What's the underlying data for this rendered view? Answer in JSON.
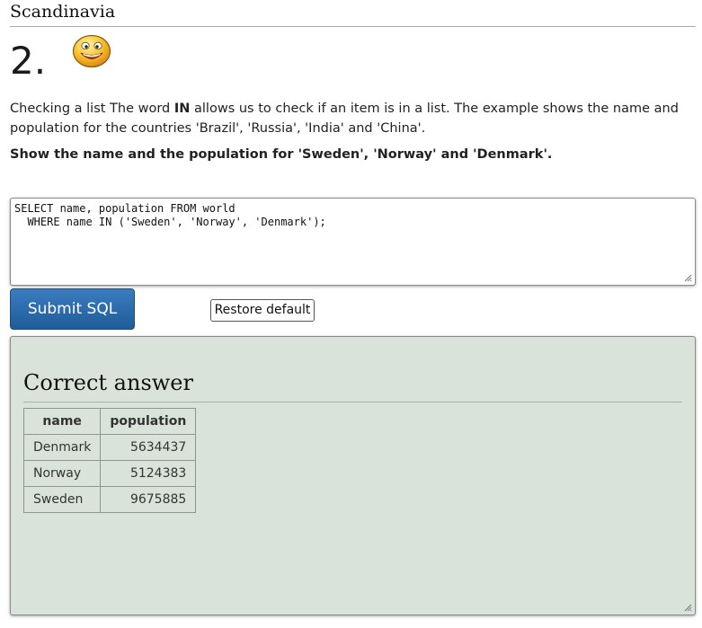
{
  "page": {
    "section_title": "Scandinavia",
    "question_number": "2.",
    "smiley_icon": "smiling-face-icon"
  },
  "question": {
    "intro_before": "Checking a list The word ",
    "keyword": "IN",
    "intro_after": " allows us to check if an item is in a list. The example shows the name and population for the countries 'Brazil', 'Russia', 'India' and 'China'.",
    "task": "Show the name and the population for 'Sweden', 'Norway' and 'Denmark'."
  },
  "editor": {
    "sql": "SELECT name, population FROM world\n  WHERE name IN ('Sweden', 'Norway', 'Denmark');"
  },
  "buttons": {
    "submit_label": "Submit SQL",
    "restore_label": "Restore default"
  },
  "answer": {
    "heading": "Correct answer",
    "columns": [
      "name",
      "population"
    ],
    "rows": [
      {
        "name": "Denmark",
        "population": "5634437"
      },
      {
        "name": "Norway",
        "population": "5124383"
      },
      {
        "name": "Sweden",
        "population": "9675885"
      }
    ]
  },
  "colors": {
    "submit_button": "#2a6aad",
    "answer_panel_bg": "#dae3d9"
  }
}
